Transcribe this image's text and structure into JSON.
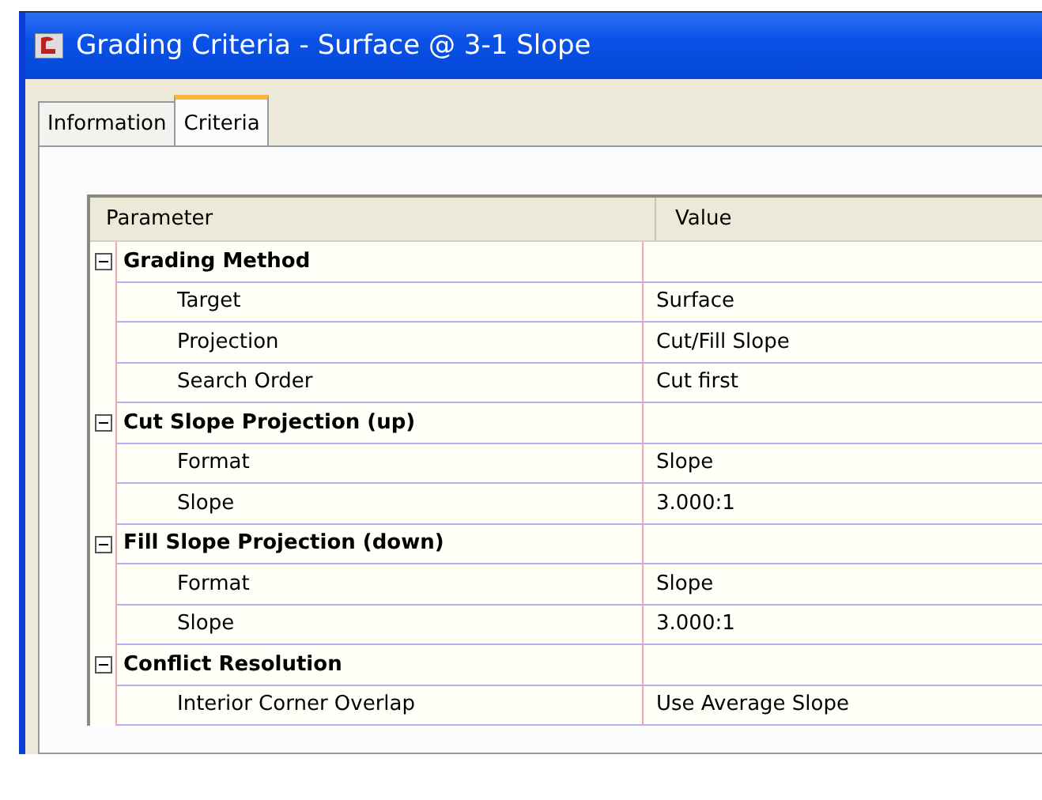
{
  "window": {
    "title": "Grading Criteria - Surface @ 3-1 Slope"
  },
  "tabs": [
    {
      "label": "Information",
      "selected": false
    },
    {
      "label": "Criteria",
      "selected": true
    }
  ],
  "grid": {
    "columns": [
      "Parameter",
      "Value"
    ],
    "groups": [
      {
        "label": "Grading Method",
        "expanded": true,
        "rows": [
          {
            "parameter": "Target",
            "value": "Surface"
          },
          {
            "parameter": "Projection",
            "value": "Cut/Fill Slope"
          },
          {
            "parameter": "Search Order",
            "value": "Cut first"
          }
        ]
      },
      {
        "label": "Cut Slope Projection (up)",
        "expanded": true,
        "rows": [
          {
            "parameter": "Format",
            "value": "Slope"
          },
          {
            "parameter": "Slope",
            "value": "3.000:1"
          }
        ]
      },
      {
        "label": "Fill Slope Projection (down)",
        "expanded": true,
        "rows": [
          {
            "parameter": "Format",
            "value": "Slope"
          },
          {
            "parameter": "Slope",
            "value": "3.000:1"
          }
        ]
      },
      {
        "label": "Conflict Resolution",
        "expanded": true,
        "rows": [
          {
            "parameter": "Interior Corner Overlap",
            "value": "Use Average Slope"
          }
        ]
      }
    ]
  }
}
